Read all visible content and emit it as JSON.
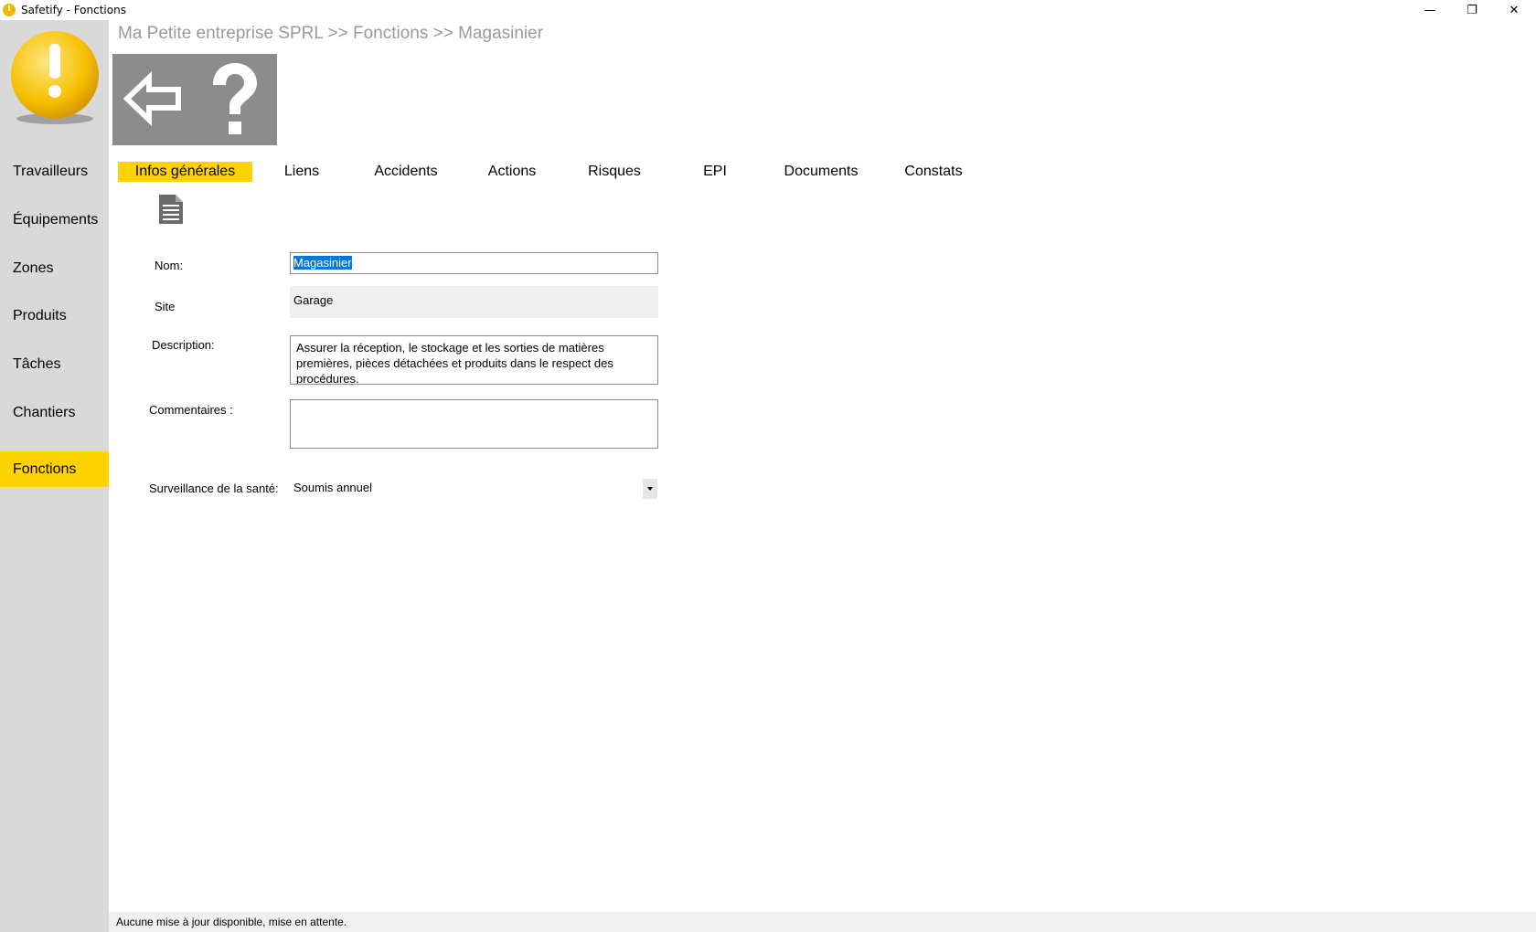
{
  "window": {
    "title": "Safetify - Fonctions",
    "minimize_glyph": "—",
    "maximize_glyph": "❐",
    "close_glyph": "✕"
  },
  "sidebar": {
    "logo_icon": "warning-exclamation-icon",
    "items": [
      {
        "label": "Travailleurs",
        "active": false
      },
      {
        "label": "Équipements",
        "active": false
      },
      {
        "label": "Zones",
        "active": false
      },
      {
        "label": "Produits",
        "active": false
      },
      {
        "label": "Tâches",
        "active": false
      },
      {
        "label": "Chantiers",
        "active": false
      },
      {
        "label": "Fonctions",
        "active": true
      }
    ]
  },
  "breadcrumb": "Ma Petite entreprise SPRL >> Fonctions >> Magasinier",
  "toolbar": {
    "back_icon": "back-arrow-icon",
    "help_icon": "help-question-icon"
  },
  "tabs": [
    {
      "label": "Infos générales",
      "active": true
    },
    {
      "label": "Liens",
      "active": false
    },
    {
      "label": "Accidents",
      "active": false
    },
    {
      "label": "Actions",
      "active": false
    },
    {
      "label": "Risques",
      "active": false
    },
    {
      "label": "EPI",
      "active": false
    },
    {
      "label": "Documents",
      "active": false
    },
    {
      "label": "Constats",
      "active": false
    }
  ],
  "form": {
    "nom_label": "Nom:",
    "nom_value": "Magasinier",
    "site_label": "Site",
    "site_value": "Garage",
    "description_label": "Description:",
    "description_value": "Assurer la réception, le stockage et les sorties de matières premières, pièces détachées et produits dans le respect des procédures.",
    "commentaires_label": "Commentaires :",
    "commentaires_value": "",
    "surveillance_label": "Surveillance de la santé:",
    "surveillance_value": "Soumis annuel"
  },
  "status_bar": "Aucune mise à jour disponible, mise en attente.",
  "colors": {
    "accent": "#ffd200",
    "sidebar_bg": "#d9d9d9",
    "toolbar_bg": "#8c8c8c"
  }
}
